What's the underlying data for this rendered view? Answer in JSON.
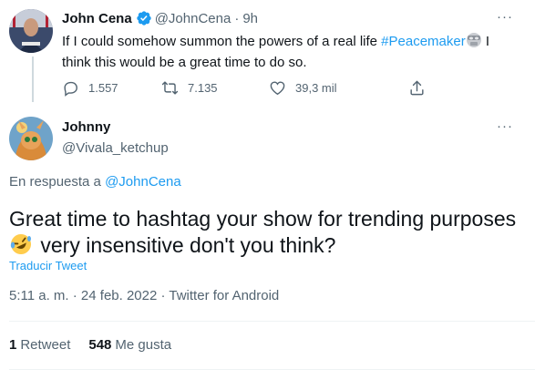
{
  "quoted": {
    "name": "John Cena",
    "handle": "@JohnCena",
    "dot": "·",
    "time": "9h",
    "more": "···",
    "text_before": "If I could somehow summon the powers of a real life ",
    "hashtag": "#Peacemaker",
    "text_after": " I think this would be a great time to do so.",
    "replies": "1.557",
    "retweets": "7.135",
    "likes": "39,3 mil"
  },
  "reply": {
    "name": "Johnny",
    "handle": "@Vivala_ketchup",
    "more": "···",
    "reply_prefix": "En respuesta a ",
    "reply_target": "@JohnCena",
    "text": "Great time to hashtag your show for trending purposes",
    "text_line2": " very insensitive don't you think?",
    "translate": "Traducir Tweet",
    "meta": "5:11 a. m. · 24 feb. 2022 · Twitter for Android",
    "retweet_count": "1",
    "retweet_label": "Retweet",
    "like_count": "548",
    "like_label": "Me gusta"
  },
  "icons": {
    "verified": "verified-badge-icon",
    "reply": "reply-icon",
    "retweet": "retweet-icon",
    "like": "heart-icon",
    "share": "share-icon",
    "emoji_ghost": "alien-mask-emoji",
    "emoji_rofl": "rolling-laughing-emoji"
  },
  "colors": {
    "link": "#1d9bf0",
    "muted": "#536471",
    "text": "#0f1419",
    "divider": "#eff3f4"
  }
}
